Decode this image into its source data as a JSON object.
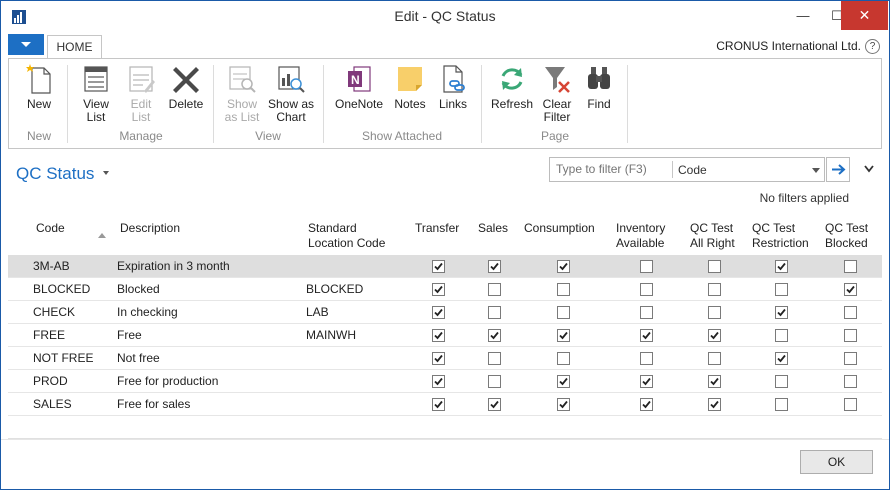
{
  "window": {
    "title": "Edit - QC Status",
    "minimize": "—",
    "maximize": "☐",
    "close": "✕"
  },
  "ribbon_tabs": {
    "home": "HOME",
    "company": "CRONUS International Ltd.",
    "help": "?"
  },
  "ribbon": {
    "new": "New",
    "view_list": [
      "View",
      "List"
    ],
    "edit_list": [
      "Edit",
      "List"
    ],
    "delete": "Delete",
    "show_as_list": [
      "Show",
      "as List"
    ],
    "show_as_chart": [
      "Show as",
      "Chart"
    ],
    "onenote": "OneNote",
    "notes": "Notes",
    "links": "Links",
    "refresh": "Refresh",
    "clear_filter": [
      "Clear",
      "Filter"
    ],
    "find": "Find",
    "groups": {
      "new": "New",
      "manage": "Manage",
      "view": "View",
      "show_attached": "Show Attached",
      "page": "Page"
    }
  },
  "page": {
    "title": "QC Status",
    "filter_placeholder": "Type to filter (F3)",
    "filter_field": "Code",
    "no_filters": "No filters applied"
  },
  "columns": {
    "code": "Code",
    "description": "Description",
    "standard_location": [
      "Standard",
      "Location Code"
    ],
    "transfer": "Transfer",
    "sales": "Sales",
    "consumption": "Consumption",
    "inventory_available": [
      "Inventory",
      "Available"
    ],
    "qc_all_right": [
      "QC Test",
      "All Right"
    ],
    "qc_restriction": [
      "QC Test",
      "Restriction"
    ],
    "qc_blocked": [
      "QC Test",
      "Blocked"
    ]
  },
  "rows": [
    {
      "code": "3M-AB",
      "description": "Expiration in 3 month",
      "location": "",
      "flags": [
        true,
        true,
        true,
        false,
        false,
        true,
        false
      ]
    },
    {
      "code": "BLOCKED",
      "description": "Blocked",
      "location": "BLOCKED",
      "flags": [
        true,
        false,
        false,
        false,
        false,
        false,
        true
      ]
    },
    {
      "code": "CHECK",
      "description": "In checking",
      "location": "LAB",
      "flags": [
        true,
        false,
        false,
        false,
        false,
        true,
        false
      ]
    },
    {
      "code": "FREE",
      "description": "Free",
      "location": "MAINWH",
      "flags": [
        true,
        true,
        true,
        true,
        true,
        false,
        false
      ]
    },
    {
      "code": "NOT FREE",
      "description": "Not free",
      "location": "",
      "flags": [
        true,
        false,
        false,
        false,
        false,
        true,
        false
      ]
    },
    {
      "code": "PROD",
      "description": "Free for production",
      "location": "",
      "flags": [
        true,
        false,
        true,
        true,
        true,
        false,
        false
      ]
    },
    {
      "code": "SALES",
      "description": "Free for sales",
      "location": "",
      "flags": [
        true,
        true,
        true,
        true,
        true,
        false,
        false
      ]
    }
  ],
  "footer": {
    "ok": "OK"
  }
}
